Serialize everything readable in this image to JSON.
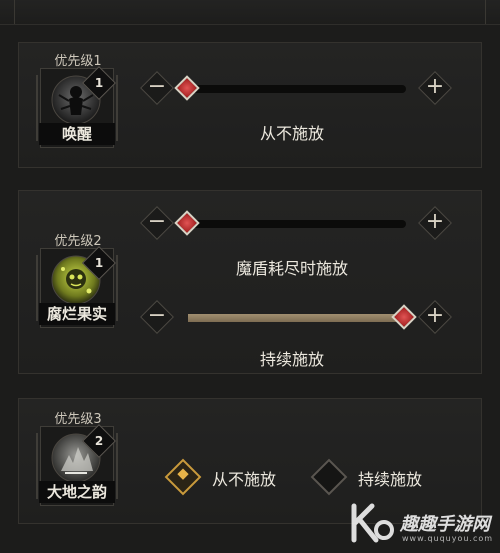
{
  "skills": [
    {
      "priority": "优先级1",
      "badge": "1",
      "name": "唤醒",
      "icon": "awaken-skill-icon",
      "controls": [
        {
          "minus": "−",
          "plus": "+",
          "level": 0.0,
          "caption": "从不施放"
        }
      ]
    },
    {
      "priority": "优先级2",
      "badge": "1",
      "name": "腐烂果实",
      "icon": "rotten-fruit-skill-icon",
      "controls": [
        {
          "minus": "−",
          "plus": "+",
          "level": 0.0,
          "caption": "魔盾耗尽时施放"
        },
        {
          "minus": "−",
          "plus": "+",
          "level": 1.0,
          "caption": "持续施放"
        }
      ]
    },
    {
      "priority": "优先级3",
      "badge": "2",
      "name": "大地之韵",
      "icon": "earth-rhythm-skill-icon",
      "options": [
        {
          "label": "从不施放",
          "checked": true
        },
        {
          "label": "持续施放",
          "checked": false
        }
      ]
    }
  ],
  "watermark": {
    "text": "趣趣手游网",
    "url": "www.ququyou.com",
    "logo": "kq-logo-icon"
  },
  "colors": {
    "accent": "#c99a3c",
    "thumb": "#d33a3a",
    "fill": "#8f7d60",
    "background": "#1c1c1b"
  }
}
